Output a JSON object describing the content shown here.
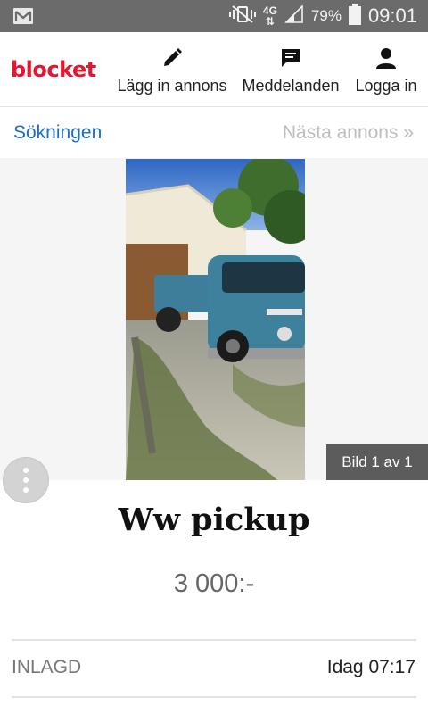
{
  "status_bar": {
    "network_type": "4G",
    "battery_percent": "79%",
    "time": "09:01",
    "icons": [
      "mail-icon",
      "vibrate-icon",
      "data-arrows-icon",
      "signal-icon",
      "battery-icon"
    ]
  },
  "header": {
    "logo": "blocket",
    "nav": [
      {
        "label": "Lägg in annons",
        "icon": "pencil-icon"
      },
      {
        "label": "Meddelanden",
        "icon": "message-icon"
      },
      {
        "label": "Logga in",
        "icon": "person-icon"
      }
    ]
  },
  "subnav": {
    "back_label": "Sökningen",
    "next_label": "Nästa annons »"
  },
  "gallery": {
    "counter": "Bild 1 av 1"
  },
  "ad": {
    "title": "Ww pickup",
    "price": "3 000:-",
    "posted_label": "INLAGD",
    "posted_value": "Idag 07:17"
  },
  "colors": {
    "brand": "#e5172f",
    "link": "#1d6fbf",
    "status_bar": "#6b6b6b"
  }
}
